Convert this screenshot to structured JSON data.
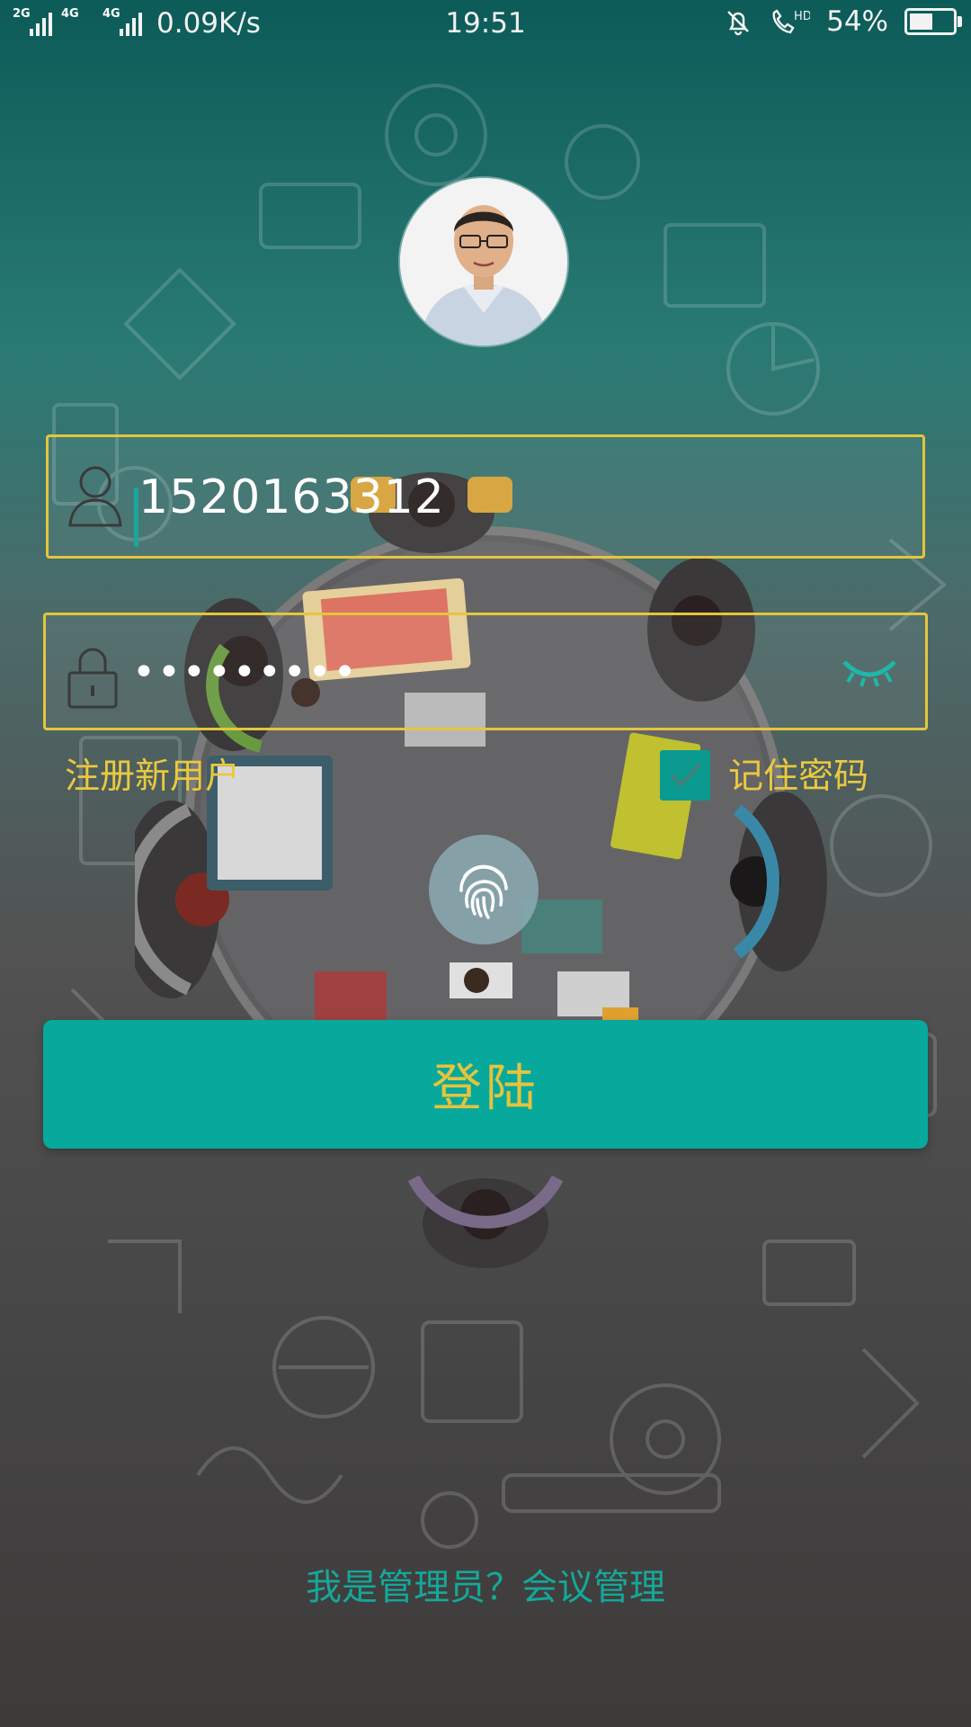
{
  "status_bar": {
    "signal1_tag": "2G",
    "signal2_tag": "4G",
    "signal2_tag_b": "4G",
    "net_speed": "0.09K/s",
    "time": "19:51",
    "battery": "54%",
    "battery_level": 0.54,
    "icons": [
      "signal-icon",
      "signal-icon",
      "alarm-off-icon",
      "hd-call-icon",
      "battery-icon"
    ]
  },
  "login": {
    "username": "1520163312",
    "password_masked": "•••••••••",
    "register": "注册新用户",
    "remember": "记住密码",
    "remember_checked": true,
    "login_button": "登陆",
    "admin_link": "我是管理员？会议管理"
  },
  "colors": {
    "accent": "#06a99b",
    "field_border": "#e4c63a",
    "label_yellow": "#e9c93e",
    "admin_teal": "#14a89a"
  }
}
